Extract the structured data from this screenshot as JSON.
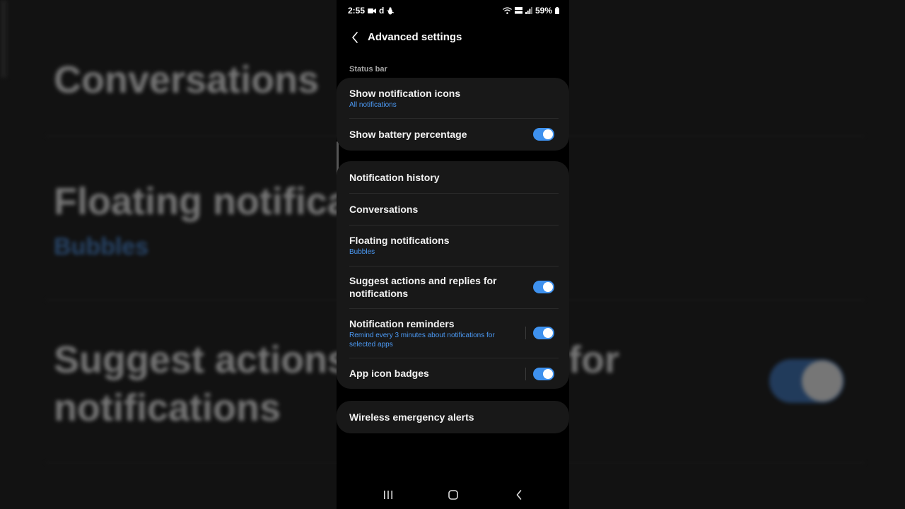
{
  "background": {
    "conversations": "Conversations",
    "floating": "Floating notifica",
    "bubbles": "Bubbles",
    "suggest_line1": "Suggest actions",
    "suggest_for": "for",
    "suggest_line2": "notifications"
  },
  "status_bar": {
    "time": "2:55",
    "carrier_letter": "d",
    "battery": "59%",
    "icons": [
      "video-record-icon",
      "app-d-icon",
      "bug-icon",
      "wifi-icon",
      "volte-icon",
      "signal-icon",
      "battery-icon"
    ]
  },
  "header": {
    "title": "Advanced settings",
    "back_icon": "back-arrow-icon"
  },
  "status_bar_section": {
    "label": "Status bar",
    "items": [
      {
        "title": "Show notification icons",
        "subtitle": "All notifications"
      },
      {
        "title": "Show battery percentage",
        "toggle_on": true
      }
    ]
  },
  "notifications_section": {
    "items": [
      {
        "title": "Notification history"
      },
      {
        "title": "Conversations"
      },
      {
        "title": "Floating notifications",
        "subtitle": "Bubbles"
      },
      {
        "title": "Suggest actions and replies for notifications",
        "toggle_on": true
      },
      {
        "title": "Notification reminders",
        "subtitle": "Remind every 3 minutes about notifications for selected apps",
        "toggle_on": true
      },
      {
        "title": "App icon badges",
        "toggle_on": true
      }
    ]
  },
  "alerts_section": {
    "items": [
      {
        "title": "Wireless emergency alerts"
      }
    ]
  },
  "nav_bar": {
    "icons": [
      "recents-icon",
      "home-icon",
      "back-icon"
    ]
  },
  "colors": {
    "accent": "#3e91ee",
    "link": "#4c9bf7",
    "card": "#181818",
    "background": "#000000"
  }
}
